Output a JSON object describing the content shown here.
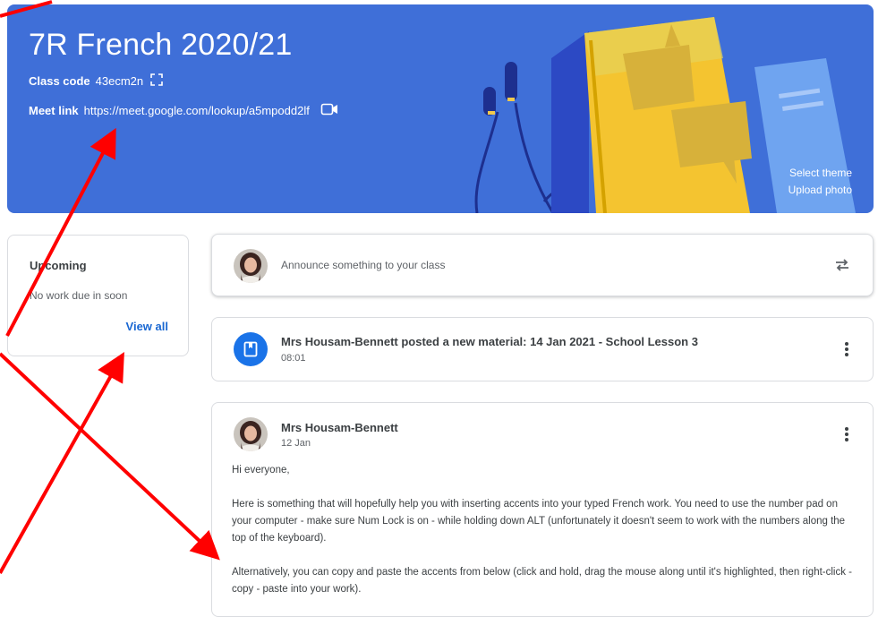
{
  "banner": {
    "title": "7R French 2020/21",
    "class_code_label": "Class code",
    "class_code": "43ecm2n",
    "meet_label": "Meet link",
    "meet_url": "https://meet.google.com/lookup/a5mpodd2lf",
    "select_theme": "Select theme",
    "upload_photo": "Upload photo"
  },
  "upcoming": {
    "title": "Upcoming",
    "empty_text": "No work due in soon",
    "view_all": "View all"
  },
  "announce": {
    "placeholder": "Announce something to your class"
  },
  "material": {
    "text": "Mrs Housam-Bennett posted a new material: 14 Jan 2021 - School Lesson 3",
    "time": "08:01"
  },
  "post": {
    "author": "Mrs Housam-Bennett",
    "date": "12 Jan",
    "greeting": "Hi everyone,",
    "paragraph1": "Here is something that will hopefully help you with inserting accents into your typed French work. You need to use the number pad on your computer - make sure Num Lock is on - while holding down ALT (unfortunately it doesn't seem to work with the numbers along the top of the keyboard).",
    "paragraph2": "Alternatively, you can copy and paste the accents from below (click and hold, drag the mouse along until it's highlighted, then right-click - copy - paste into your work)."
  },
  "colors": {
    "banner": "#3f6fd8",
    "accent": "#1a73e8",
    "link": "#1967d2",
    "annotation_arrow": "#ff0000"
  }
}
